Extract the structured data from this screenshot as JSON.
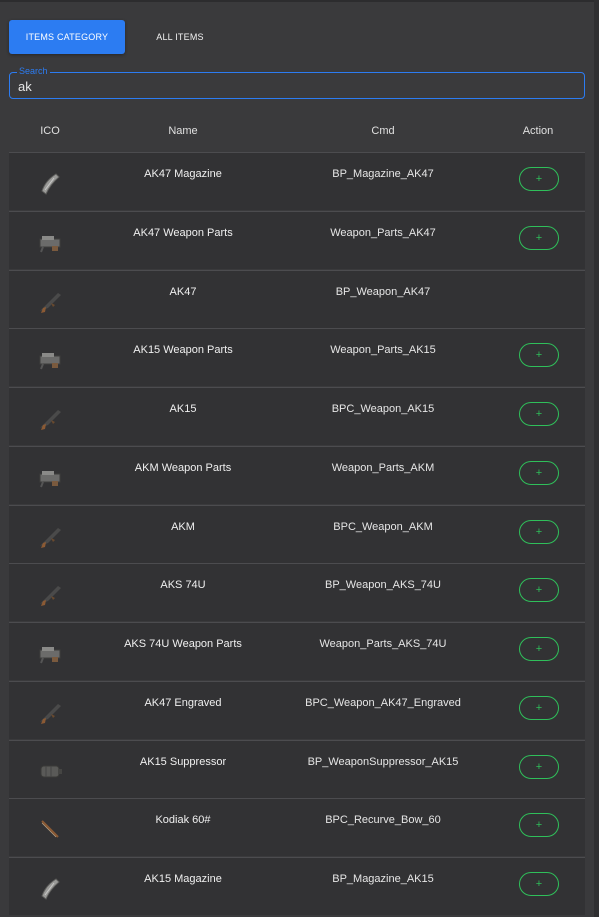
{
  "tabs": [
    {
      "label": "ITEMS CATEGORY",
      "active": true
    },
    {
      "label": "ALL ITEMS",
      "active": false
    }
  ],
  "search": {
    "label": "Search",
    "value": "ak"
  },
  "table": {
    "headers": {
      "ico": "ICO",
      "name": "Name",
      "cmd": "Cmd",
      "action": "Action"
    },
    "add_label": "+",
    "rows": [
      {
        "icon": "magazine-icon",
        "name": "AK47 Magazine",
        "cmd": "BP_Magazine_AK47",
        "has_add": true
      },
      {
        "icon": "weapon-parts-icon",
        "name": "AK47 Weapon Parts",
        "cmd": "Weapon_Parts_AK47",
        "has_add": true
      },
      {
        "icon": "rifle-icon",
        "name": "AK47",
        "cmd": "BP_Weapon_AK47",
        "has_add": false
      },
      {
        "icon": "weapon-parts-icon",
        "name": "AK15 Weapon Parts",
        "cmd": "Weapon_Parts_AK15",
        "has_add": true
      },
      {
        "icon": "rifle-icon",
        "name": "AK15",
        "cmd": "BPC_Weapon_AK15",
        "has_add": true
      },
      {
        "icon": "weapon-parts-icon",
        "name": "AKM Weapon Parts",
        "cmd": "Weapon_Parts_AKM",
        "has_add": true
      },
      {
        "icon": "rifle-icon",
        "name": "AKM",
        "cmd": "BPC_Weapon_AKM",
        "has_add": true
      },
      {
        "icon": "rifle-icon",
        "name": "AKS 74U",
        "cmd": "BP_Weapon_AKS_74U",
        "has_add": true
      },
      {
        "icon": "weapon-parts-icon",
        "name": "AKS 74U Weapon Parts",
        "cmd": "Weapon_Parts_AKS_74U",
        "has_add": true
      },
      {
        "icon": "rifle-icon",
        "name": "AK47 Engraved",
        "cmd": "BPC_Weapon_AK47_Engraved",
        "has_add": true
      },
      {
        "icon": "suppressor-icon",
        "name": "AK15 Suppressor",
        "cmd": "BP_WeaponSuppressor_AK15",
        "has_add": true
      },
      {
        "icon": "bow-icon",
        "name": "Kodiak 60#",
        "cmd": "BPC_Recurve_Bow_60",
        "has_add": true
      },
      {
        "icon": "magazine-icon",
        "name": "AK15 Magazine",
        "cmd": "BP_Magazine_AK15",
        "has_add": true
      }
    ]
  }
}
